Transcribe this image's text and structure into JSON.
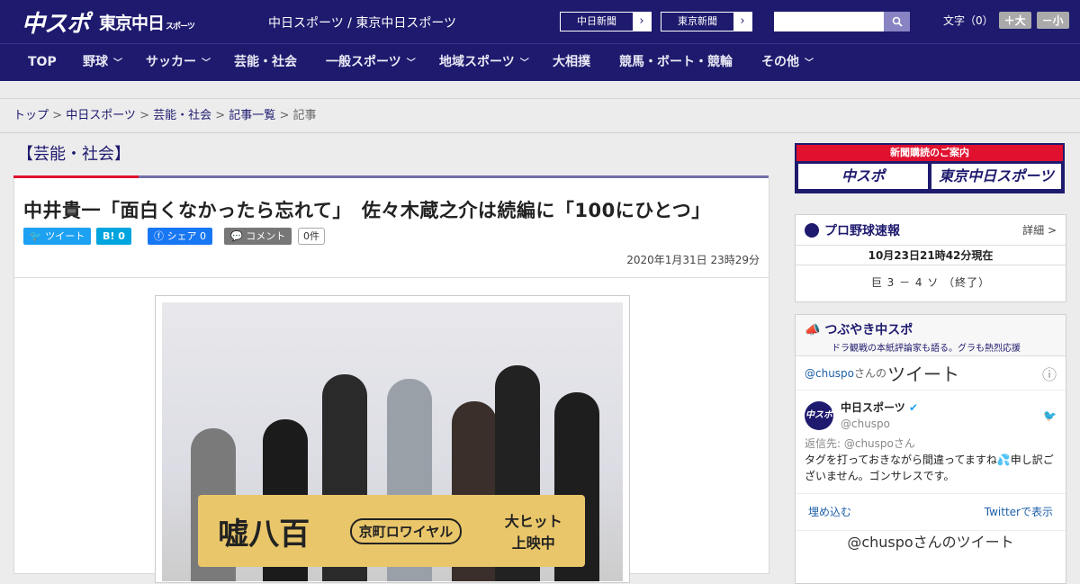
{
  "header": {
    "logo": "中スポ",
    "logo2": "東京中日",
    "logo2_small": "スポーツ",
    "site_link": "中日スポーツ / 東京中日スポーツ",
    "papers": [
      "中日新聞",
      "東京新聞"
    ],
    "fontsize": {
      "label": "文字（0）",
      "bigger": "＋大",
      "smaller": "－小"
    }
  },
  "nav": {
    "items": [
      {
        "label": "TOP"
      },
      {
        "label": "野球"
      },
      {
        "label": "サッカー"
      },
      {
        "label": "芸能・社会"
      },
      {
        "label": "一般スポーツ"
      },
      {
        "label": "地域スポーツ"
      },
      {
        "label": "大相撲"
      },
      {
        "label": "競馬・ボート・競輪"
      },
      {
        "label": "その他"
      }
    ]
  },
  "breadcrumb": {
    "items": [
      "トップ",
      "中日スポーツ",
      "芸能・社会",
      "記事一覧"
    ],
    "current": "記事"
  },
  "article": {
    "category": "【芸能・社会】",
    "headline": "中井貴一「面白くなかったら忘れて」　佐々木蔵之介は続編に「100にひとつ」",
    "share": {
      "tweet": "ツイート",
      "hatena": "B! 0",
      "facebook": "シェア 0",
      "comment": "コメント",
      "comment_count": "0件"
    },
    "date": "2020年1月31日 23時29分",
    "photo_banner": {
      "title": "嘘八百",
      "subtitle": "京町ロワイヤル",
      "tag": "大ヒット上映中"
    }
  },
  "sidebar": {
    "subscribe": {
      "header": "新聞購読のご案内",
      "tiles": [
        "中スポ",
        "東京中日スポーツ"
      ]
    },
    "baseball": {
      "title": "プロ野球速報",
      "more": "詳細 >",
      "time": "10月23日21時42分現在",
      "score": "巨 3 － 4 ソ （終了）"
    },
    "tweets": {
      "title": "つぶやき中スポ",
      "subtitle": "ドラ観戦の本紙評論家も語る。グラも熱烈応援",
      "head_handle": "@chuspo",
      "head_suffix": "さんの",
      "head_big": "ツイート",
      "user_name": "中日スポーツ",
      "user_handle": "@chuspo",
      "reply_to": "返信先: @chuspoさん",
      "text": "タグを打っておきながら間違ってますね💦申し訳ございません。ゴンサレスです。",
      "embed": "埋め込む",
      "view_on": "Twitterで表示",
      "footer": "@chuspoさんのツイート"
    }
  },
  "colors": {
    "brand": "#1e1a6e",
    "accent": "#e0102e"
  }
}
